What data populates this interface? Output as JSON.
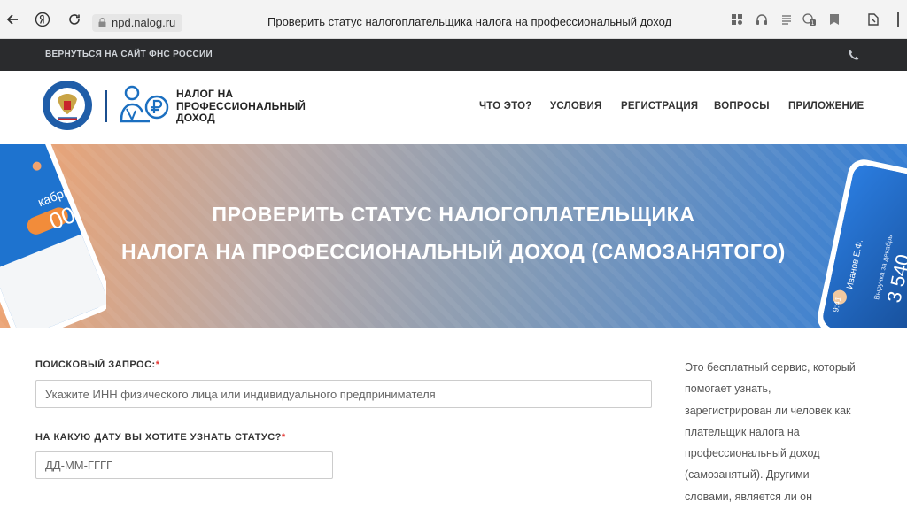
{
  "browser": {
    "url": "npd.nalog.ru",
    "title": "Проверить статус налогоплательщика налога на профессиональный доход"
  },
  "top_strip": {
    "back_link": "ВЕРНУТЬСЯ НА САЙТ ФНС РОССИИ"
  },
  "header": {
    "brand_lines": [
      "НАЛОГ НА",
      "ПРОФЕССИОНАЛЬНЫЙ",
      "ДОХОД"
    ],
    "nav": [
      "ЧТО ЭТО?",
      "УСЛОВИЯ",
      "РЕГИСТРАЦИЯ",
      "ВОПРОСЫ",
      "ПРИЛОЖЕНИЕ"
    ]
  },
  "hero": {
    "title_line1": "ПРОВЕРИТЬ СТАТУС НАЛОГОПЛАТЕЛЬЩИКА",
    "title_line2": "НАЛОГА НА ПРОФЕССИОНАЛЬНЫЙ ДОХОД (САМОЗАНЯТОГО)",
    "phone_left_amount": "00",
    "phone_left_month": "кабрь",
    "phone_right_name": "Иванов Е.Ф.",
    "phone_right_time": "9:41",
    "phone_right_caption": "Выручка за декабрь",
    "phone_right_amount": "3 540"
  },
  "form": {
    "query_label": "ПОИСКОВЫЙ ЗАПРОС:",
    "query_placeholder": "Укажите ИНН физического лица или индивидуального предпринимателя",
    "date_label": "НА КАКУЮ ДАТУ ВЫ ХОТИТЕ УЗНАТЬ СТАТУС?",
    "date_placeholder": "ДД-ММ-ГГГГ",
    "required_mark": "*"
  },
  "aside": {
    "lines": [
      "Это бесплатный сервис, который",
      "помогает узнать,",
      "зарегистрирован ли человек как",
      "плательщик налога на",
      "профессиональный доход",
      "(самозанятый). Другими",
      "словами, является ли он"
    ]
  },
  "colors": {
    "strip": "#2a2b2d",
    "brand_blue": "#1b4f8f",
    "accent_red": "#e53935"
  }
}
